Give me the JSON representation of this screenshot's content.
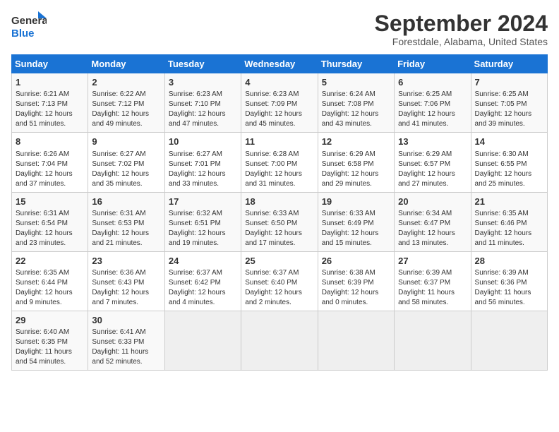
{
  "header": {
    "logo_line1": "General",
    "logo_line2": "Blue",
    "month_title": "September 2024",
    "location": "Forestdale, Alabama, United States"
  },
  "calendar": {
    "columns": [
      "Sunday",
      "Monday",
      "Tuesday",
      "Wednesday",
      "Thursday",
      "Friday",
      "Saturday"
    ],
    "weeks": [
      [
        null,
        {
          "day": 2,
          "sunrise": "6:22 AM",
          "sunset": "7:12 PM",
          "daylight": "12 hours and 49 minutes."
        },
        {
          "day": 3,
          "sunrise": "6:23 AM",
          "sunset": "7:10 PM",
          "daylight": "12 hours and 47 minutes."
        },
        {
          "day": 4,
          "sunrise": "6:23 AM",
          "sunset": "7:09 PM",
          "daylight": "12 hours and 45 minutes."
        },
        {
          "day": 5,
          "sunrise": "6:24 AM",
          "sunset": "7:08 PM",
          "daylight": "12 hours and 43 minutes."
        },
        {
          "day": 6,
          "sunrise": "6:25 AM",
          "sunset": "7:06 PM",
          "daylight": "12 hours and 41 minutes."
        },
        {
          "day": 7,
          "sunrise": "6:25 AM",
          "sunset": "7:05 PM",
          "daylight": "12 hours and 39 minutes."
        }
      ],
      [
        {
          "day": 1,
          "sunrise": "6:21 AM",
          "sunset": "7:13 PM",
          "daylight": "12 hours and 51 minutes."
        },
        {
          "day": 8,
          "sunrise": null,
          "sunset": null,
          "daylight": null
        },
        null,
        null,
        null,
        null,
        null
      ],
      [
        {
          "day": 8,
          "sunrise": "6:26 AM",
          "sunset": "7:04 PM",
          "daylight": "12 hours and 37 minutes."
        },
        {
          "day": 9,
          "sunrise": "6:27 AM",
          "sunset": "7:02 PM",
          "daylight": "12 hours and 35 minutes."
        },
        {
          "day": 10,
          "sunrise": "6:27 AM",
          "sunset": "7:01 PM",
          "daylight": "12 hours and 33 minutes."
        },
        {
          "day": 11,
          "sunrise": "6:28 AM",
          "sunset": "7:00 PM",
          "daylight": "12 hours and 31 minutes."
        },
        {
          "day": 12,
          "sunrise": "6:29 AM",
          "sunset": "6:58 PM",
          "daylight": "12 hours and 29 minutes."
        },
        {
          "day": 13,
          "sunrise": "6:29 AM",
          "sunset": "6:57 PM",
          "daylight": "12 hours and 27 minutes."
        },
        {
          "day": 14,
          "sunrise": "6:30 AM",
          "sunset": "6:55 PM",
          "daylight": "12 hours and 25 minutes."
        }
      ],
      [
        {
          "day": 15,
          "sunrise": "6:31 AM",
          "sunset": "6:54 PM",
          "daylight": "12 hours and 23 minutes."
        },
        {
          "day": 16,
          "sunrise": "6:31 AM",
          "sunset": "6:53 PM",
          "daylight": "12 hours and 21 minutes."
        },
        {
          "day": 17,
          "sunrise": "6:32 AM",
          "sunset": "6:51 PM",
          "daylight": "12 hours and 19 minutes."
        },
        {
          "day": 18,
          "sunrise": "6:33 AM",
          "sunset": "6:50 PM",
          "daylight": "12 hours and 17 minutes."
        },
        {
          "day": 19,
          "sunrise": "6:33 AM",
          "sunset": "6:49 PM",
          "daylight": "12 hours and 15 minutes."
        },
        {
          "day": 20,
          "sunrise": "6:34 AM",
          "sunset": "6:47 PM",
          "daylight": "12 hours and 13 minutes."
        },
        {
          "day": 21,
          "sunrise": "6:35 AM",
          "sunset": "6:46 PM",
          "daylight": "12 hours and 11 minutes."
        }
      ],
      [
        {
          "day": 22,
          "sunrise": "6:35 AM",
          "sunset": "6:44 PM",
          "daylight": "12 hours and 9 minutes."
        },
        {
          "day": 23,
          "sunrise": "6:36 AM",
          "sunset": "6:43 PM",
          "daylight": "12 hours and 7 minutes."
        },
        {
          "day": 24,
          "sunrise": "6:37 AM",
          "sunset": "6:42 PM",
          "daylight": "12 hours and 4 minutes."
        },
        {
          "day": 25,
          "sunrise": "6:37 AM",
          "sunset": "6:40 PM",
          "daylight": "12 hours and 2 minutes."
        },
        {
          "day": 26,
          "sunrise": "6:38 AM",
          "sunset": "6:39 PM",
          "daylight": "12 hours and 0 minutes."
        },
        {
          "day": 27,
          "sunrise": "6:39 AM",
          "sunset": "6:37 PM",
          "daylight": "11 hours and 58 minutes."
        },
        {
          "day": 28,
          "sunrise": "6:39 AM",
          "sunset": "6:36 PM",
          "daylight": "11 hours and 56 minutes."
        }
      ],
      [
        {
          "day": 29,
          "sunrise": "6:40 AM",
          "sunset": "6:35 PM",
          "daylight": "11 hours and 54 minutes."
        },
        {
          "day": 30,
          "sunrise": "6:41 AM",
          "sunset": "6:33 PM",
          "daylight": "11 hours and 52 minutes."
        },
        null,
        null,
        null,
        null,
        null
      ]
    ]
  }
}
